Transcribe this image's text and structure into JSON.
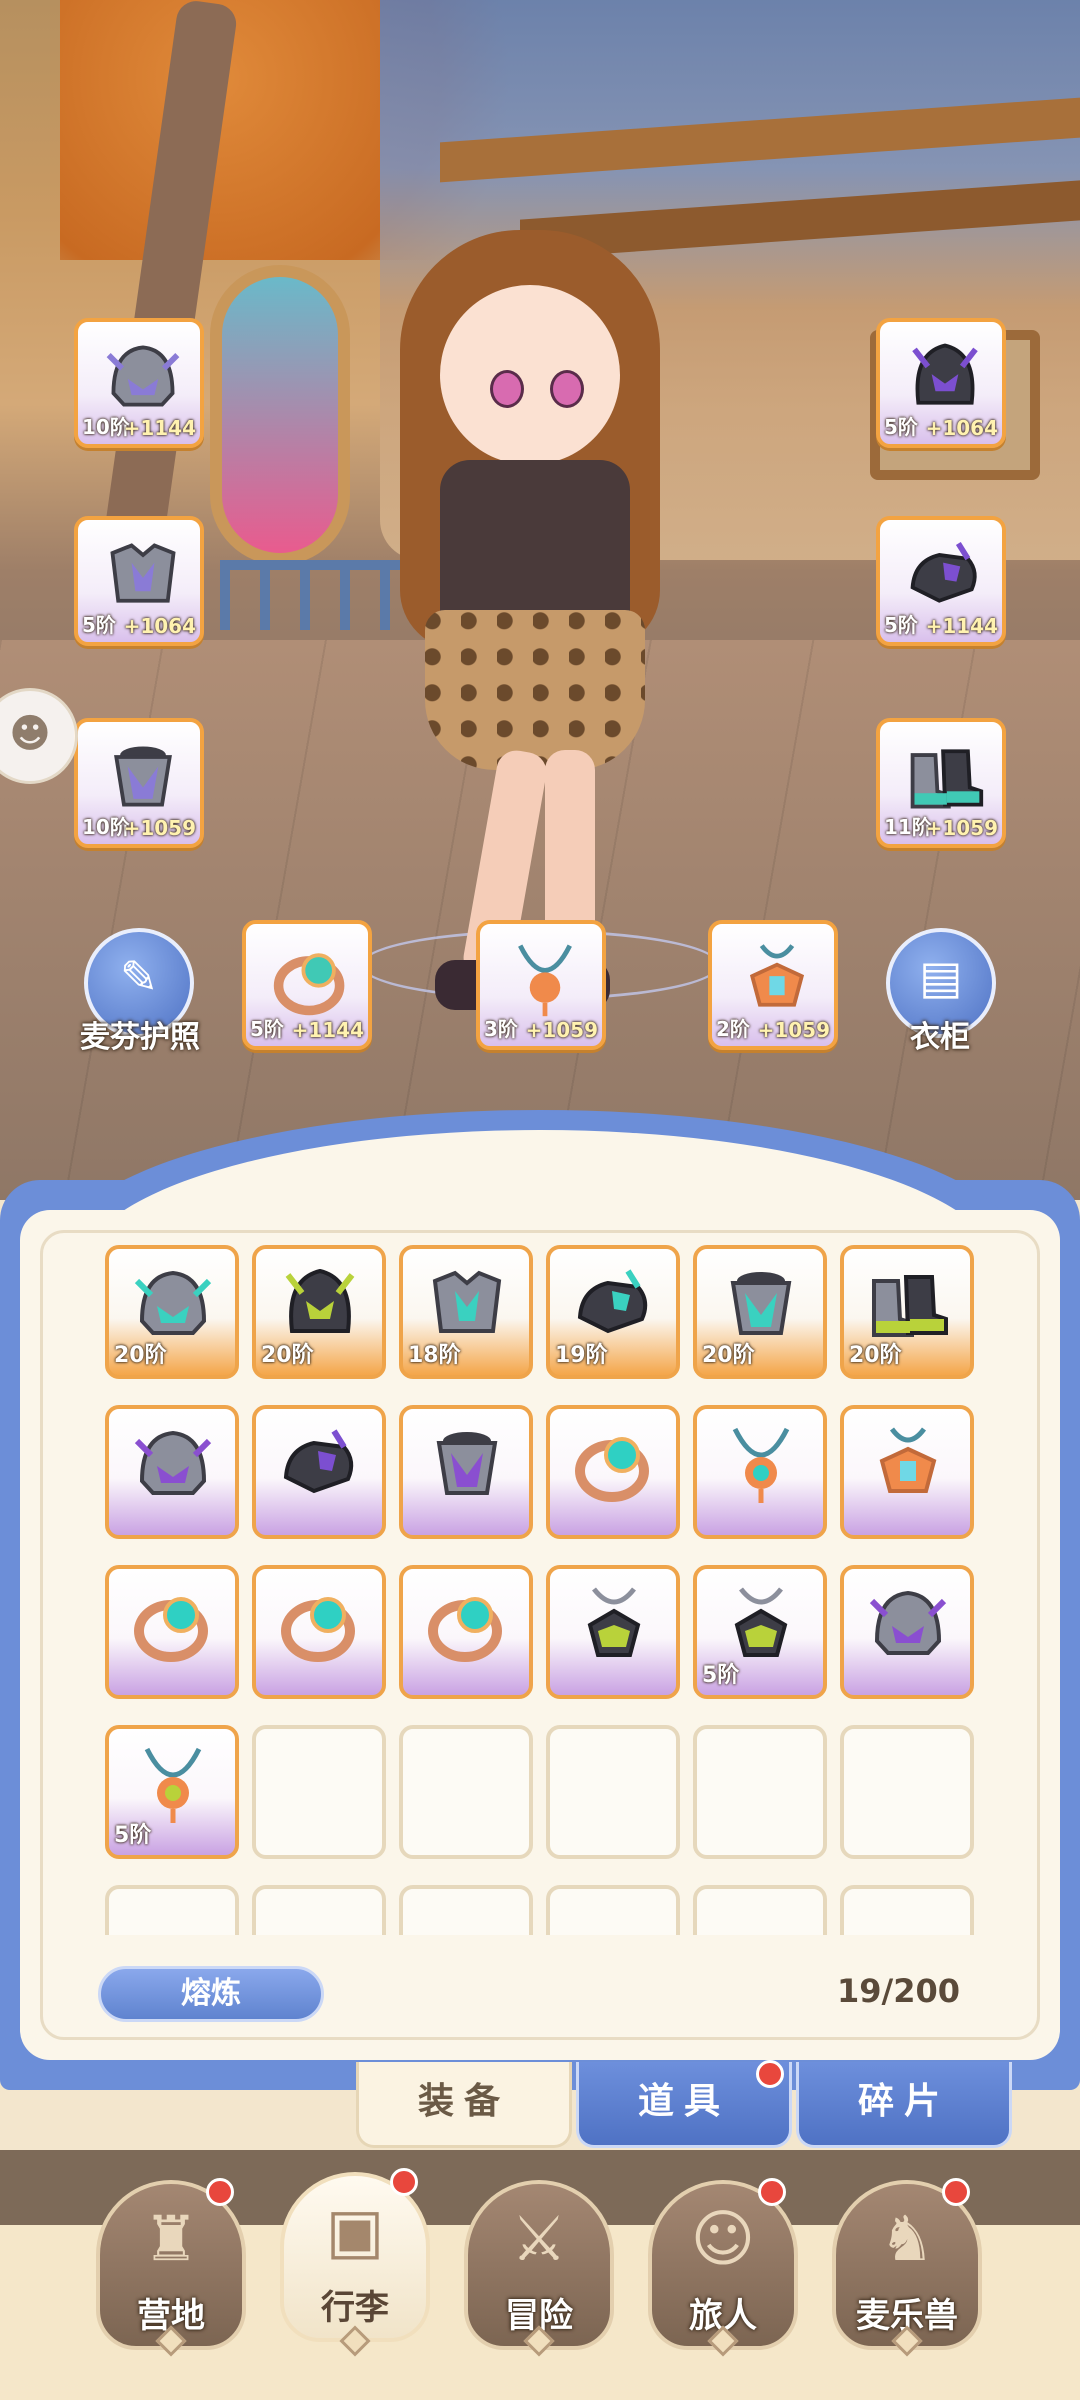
{
  "equip_slots": [
    {
      "tier": "10阶",
      "bonus": "+1144",
      "icon": "helmet-icon",
      "color": "#8a7bd6"
    },
    {
      "tier": "5阶",
      "bonus": "+1064",
      "icon": "dark-helmet-icon",
      "color": "#7c4fd0"
    },
    {
      "tier": "5阶",
      "bonus": "+1064",
      "icon": "armor-icon",
      "color": "#8a7bd6"
    },
    {
      "tier": "5阶",
      "bonus": "+1144",
      "icon": "gauntlet-icon",
      "color": "#7c4fd0"
    },
    {
      "tier": "10阶",
      "bonus": "+1059",
      "icon": "chestplate-icon",
      "color": "#8a7bd6"
    },
    {
      "tier": "11阶",
      "bonus": "+1059",
      "icon": "boots-icon",
      "color": "#40c9b5"
    },
    {
      "tier": "5阶",
      "bonus": "+1144",
      "icon": "ring-icon",
      "color": "#40c9b5"
    },
    {
      "tier": "3阶",
      "bonus": "+1059",
      "icon": "necklace-icon",
      "color": "#f08a4b"
    },
    {
      "tier": "2阶",
      "bonus": "+1059",
      "icon": "amulet-icon",
      "color": "#f08a4b"
    }
  ],
  "passport_label": "麦芬护照",
  "wardrobe_label": "衣柜",
  "bag": {
    "items": [
      {
        "tier": "20阶",
        "icon": "helmet-icon",
        "rarity": "orange",
        "color": "#3ad1c0"
      },
      {
        "tier": "20阶",
        "icon": "dark-helmet-icon",
        "rarity": "orange",
        "color": "#b9d23a"
      },
      {
        "tier": "18阶",
        "icon": "armor-icon",
        "rarity": "orange",
        "color": "#3ad1c0"
      },
      {
        "tier": "19阶",
        "icon": "gauntlet-icon",
        "rarity": "orange",
        "color": "#3ad1c0"
      },
      {
        "tier": "20阶",
        "icon": "chestplate-icon",
        "rarity": "orange",
        "color": "#3ad1c0"
      },
      {
        "tier": "20阶",
        "icon": "boots-icon",
        "rarity": "orange",
        "color": "#b9d23a"
      },
      {
        "tier": "",
        "icon": "helmet-icon",
        "rarity": "purple",
        "color": "#8a4fd0"
      },
      {
        "tier": "",
        "icon": "gauntlet-icon",
        "rarity": "purple",
        "color": "#7c4fd0"
      },
      {
        "tier": "",
        "icon": "chestplate-icon",
        "rarity": "purple",
        "color": "#8a4fd0"
      },
      {
        "tier": "",
        "icon": "ring-icon",
        "rarity": "purple",
        "color": "#2fd0c3"
      },
      {
        "tier": "",
        "icon": "necklace-icon",
        "rarity": "purple",
        "color": "#2fd0c3"
      },
      {
        "tier": "",
        "icon": "amulet-icon",
        "rarity": "purple",
        "color": "#f08a4b"
      },
      {
        "tier": "",
        "icon": "ring-icon",
        "rarity": "purple",
        "color": "#2fd0c3"
      },
      {
        "tier": "",
        "icon": "ring-icon",
        "rarity": "purple",
        "color": "#2fd0c3"
      },
      {
        "tier": "",
        "icon": "ring-icon",
        "rarity": "purple",
        "color": "#2fd0c3"
      },
      {
        "tier": "",
        "icon": "pendant-icon",
        "rarity": "purple",
        "color": "#b9d23a"
      },
      {
        "tier": "5阶",
        "icon": "pendant-icon",
        "rarity": "purple",
        "color": "#b9d23a"
      },
      {
        "tier": "",
        "icon": "helmet-icon",
        "rarity": "purple",
        "color": "#8a4fd0"
      },
      {
        "tier": "5阶",
        "icon": "necklace-icon",
        "rarity": "purple",
        "color": "#b9d23a"
      }
    ],
    "empty_slots": 11,
    "smelt_label": "熔炼",
    "capacity": "19/200"
  },
  "tabs": [
    {
      "label": "装备",
      "active": true,
      "badge": false
    },
    {
      "label": "道具",
      "active": false,
      "badge": true
    },
    {
      "label": "碎片",
      "active": false,
      "badge": false
    }
  ],
  "nav": [
    {
      "label": "营地",
      "icon": "castle-icon",
      "badge": true,
      "active": false
    },
    {
      "label": "行李",
      "icon": "chest-icon",
      "badge": true,
      "active": true
    },
    {
      "label": "冒险",
      "icon": "swords-icon",
      "badge": false,
      "active": false
    },
    {
      "label": "旅人",
      "icon": "character-icon",
      "badge": true,
      "active": false
    },
    {
      "label": "麦乐兽",
      "icon": "pet-icon",
      "badge": true,
      "active": false
    }
  ],
  "colors": {
    "panel_blue": "#6c8ed8",
    "orange_border": "#efa44a",
    "badge_red": "#e8473d"
  }
}
